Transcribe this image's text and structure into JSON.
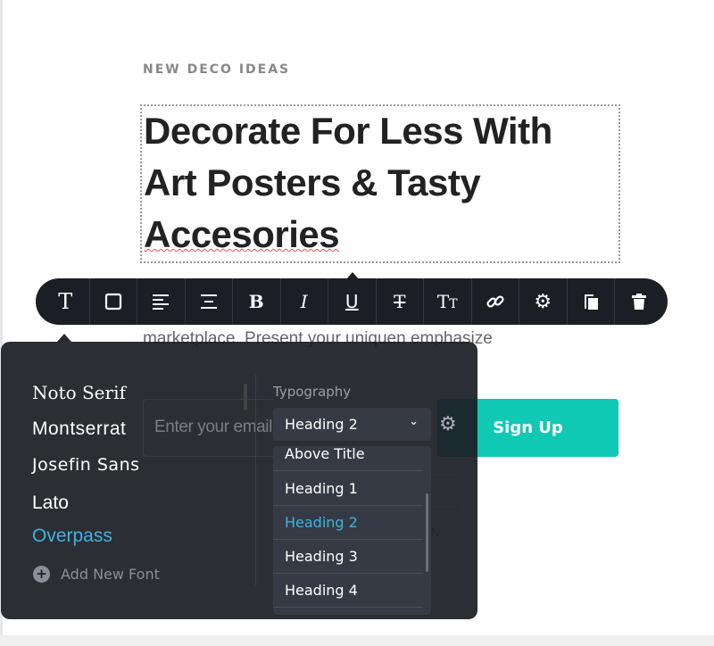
{
  "page": {
    "eyebrow": "NEW DECO IDEAS",
    "title_lines": [
      "Decorate For Less With",
      "Art Posters & Tasty",
      "Accesories"
    ],
    "body_text": "Differentiate and you stand out in a very crowded marketplace. Present your uniquen emphasize",
    "email_placeholder": "Enter your email",
    "signup_label": "Sign Up",
    "partial_text": "p.",
    "accent": "#10c9b4"
  },
  "toolbar": {
    "items": [
      {
        "icon": "text-icon",
        "glyph": "T"
      },
      {
        "icon": "box-icon"
      },
      {
        "icon": "align-left-icon"
      },
      {
        "icon": "align-center-icon"
      },
      {
        "icon": "bold-icon",
        "glyph": "B"
      },
      {
        "icon": "italic-icon",
        "glyph": "I"
      },
      {
        "icon": "underline-icon",
        "glyph": "U"
      },
      {
        "icon": "strikethrough-icon",
        "glyph": "T"
      },
      {
        "icon": "text-size-icon",
        "glyph": "Tт"
      },
      {
        "icon": "link-icon",
        "glyph": "🔗"
      },
      {
        "icon": "gear-icon",
        "glyph": "⚙"
      },
      {
        "icon": "copy-icon"
      },
      {
        "icon": "trash-icon"
      }
    ]
  },
  "font_panel": {
    "fonts": [
      "Noto Serif",
      "Montserrat",
      "Josefin Sans",
      "Lato",
      "Overpass"
    ],
    "selected_font": "Overpass",
    "add_font_label": "Add New Font",
    "typography_label": "Typography",
    "selected_style": "Heading 2",
    "style_options": [
      "Above Title",
      "Heading 1",
      "Heading 2",
      "Heading 3",
      "Heading 4"
    ],
    "highlight_color": "#3db4e0"
  }
}
